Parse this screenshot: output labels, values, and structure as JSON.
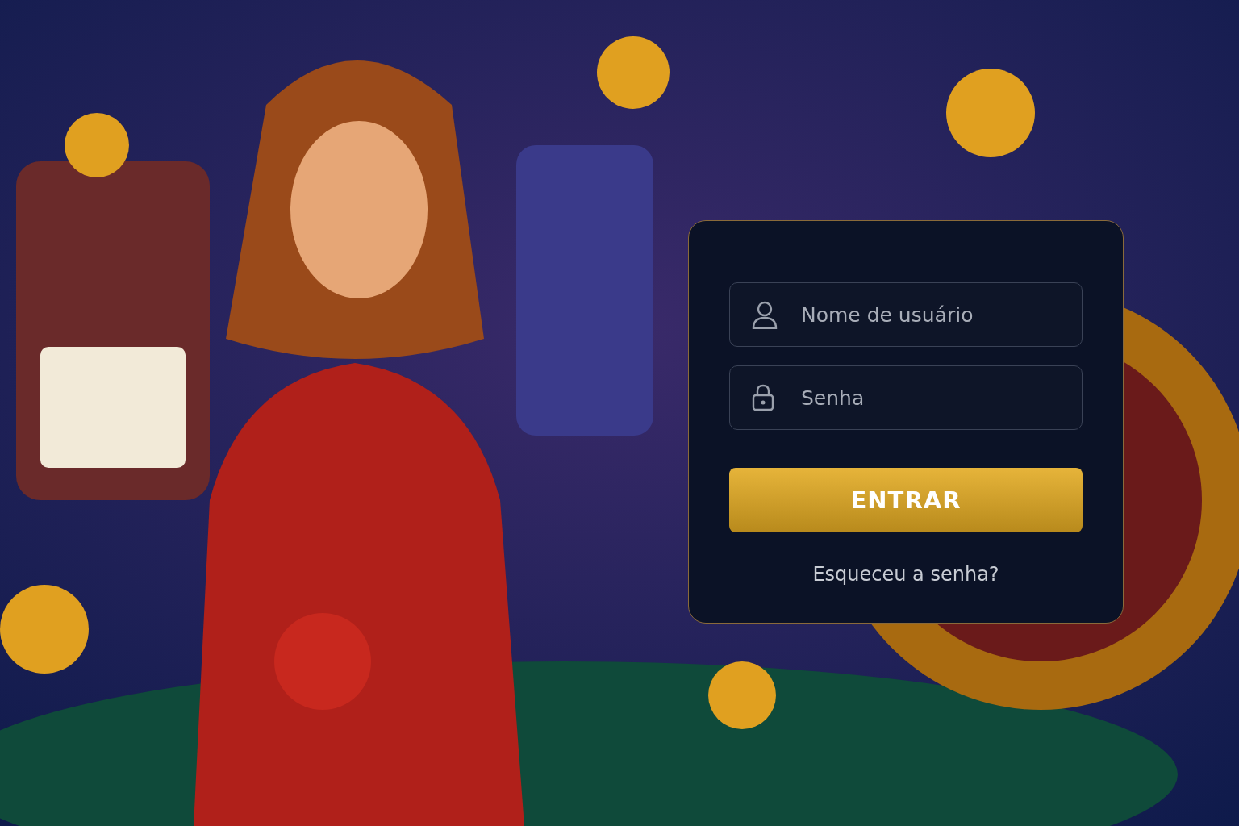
{
  "login": {
    "username": {
      "placeholder": "Nome de usuário"
    },
    "password": {
      "placeholder": "Senha"
    },
    "submit": "ENTRAR",
    "forgot_link": "Esqueceu a senha?"
  }
}
